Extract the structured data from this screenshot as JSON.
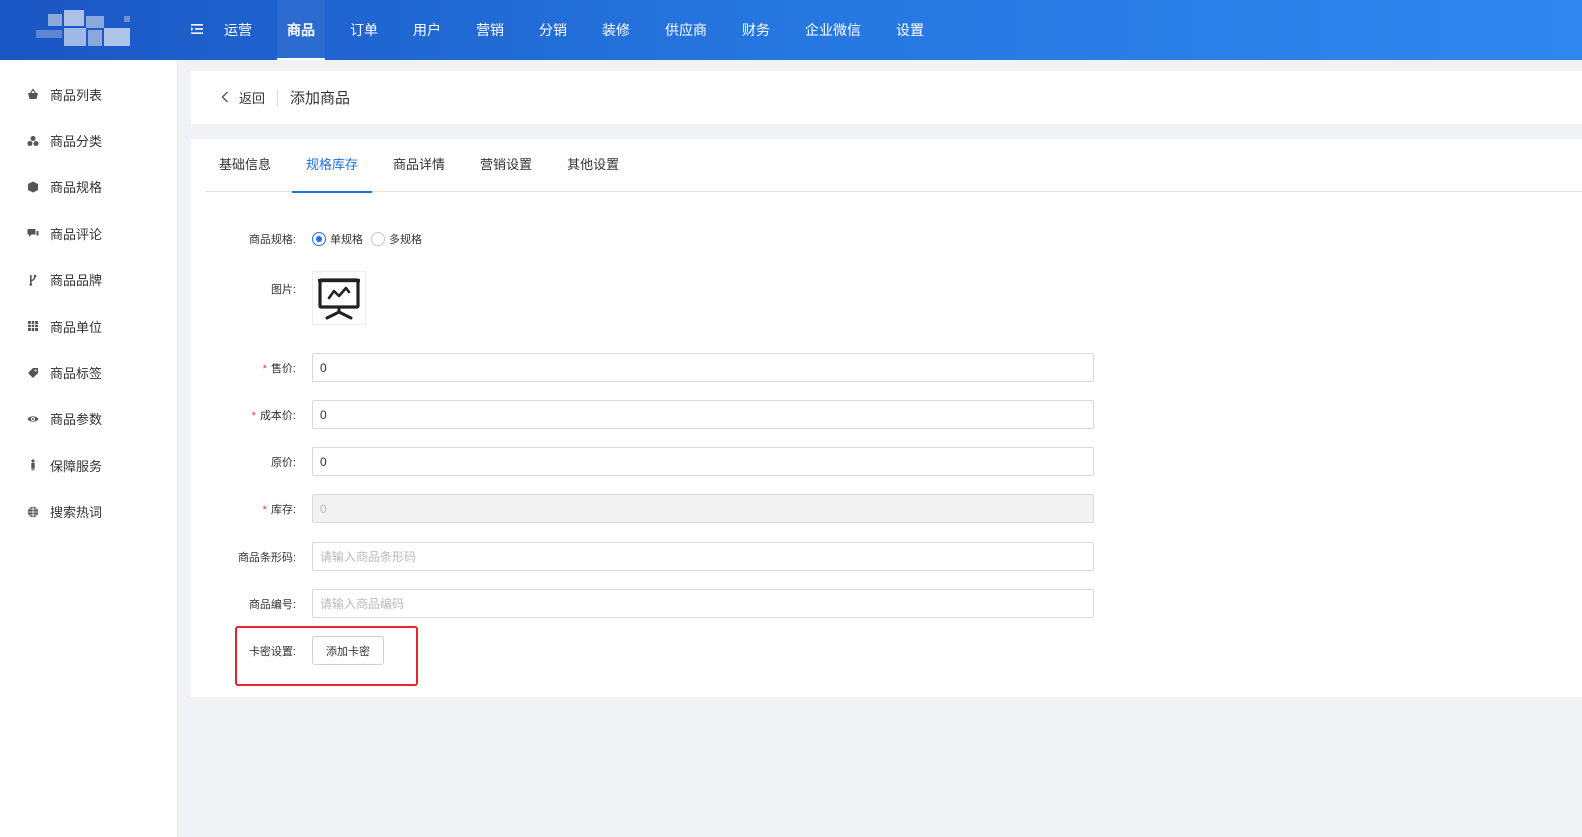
{
  "header": {
    "nav": [
      {
        "label": "运营"
      },
      {
        "label": "商品"
      },
      {
        "label": "订单"
      },
      {
        "label": "用户"
      },
      {
        "label": "营销"
      },
      {
        "label": "分销"
      },
      {
        "label": "装修"
      },
      {
        "label": "供应商"
      },
      {
        "label": "财务"
      },
      {
        "label": "企业微信"
      },
      {
        "label": "设置"
      }
    ],
    "active_nav": "商品",
    "colors": {
      "gradient_start": "#1a56c4",
      "gradient_end": "#2f86ee"
    }
  },
  "sidebar": {
    "items": [
      {
        "label": "商品列表",
        "icon": "basket-icon"
      },
      {
        "label": "商品分类",
        "icon": "cubes-icon"
      },
      {
        "label": "商品规格",
        "icon": "cube-icon"
      },
      {
        "label": "商品评论",
        "icon": "comments-icon"
      },
      {
        "label": "商品品牌",
        "icon": "branch-icon"
      },
      {
        "label": "商品单位",
        "icon": "grid-icon"
      },
      {
        "label": "商品标签",
        "icon": "tag-icon"
      },
      {
        "label": "商品参数",
        "icon": "eye-icon"
      },
      {
        "label": "保障服务",
        "icon": "person-icon"
      },
      {
        "label": "搜索热词",
        "icon": "globe-icon"
      }
    ]
  },
  "breadcrumb": {
    "back_label": "返回",
    "title": "添加商品"
  },
  "tabs": [
    {
      "label": "基础信息"
    },
    {
      "label": "规格库存"
    },
    {
      "label": "商品详情"
    },
    {
      "label": "营销设置"
    },
    {
      "label": "其他设置"
    }
  ],
  "active_tab": "规格库存",
  "form": {
    "spec": {
      "label": "商品规格:",
      "options": [
        "单规格",
        "多规格"
      ],
      "selected": "单规格"
    },
    "image": {
      "label": "图片:",
      "icon": "presentation-board-icon"
    },
    "price": {
      "label": "售价:",
      "required": true,
      "value": "0"
    },
    "cost": {
      "label": "成本价:",
      "required": true,
      "value": "0"
    },
    "original": {
      "label": "原价:",
      "required": false,
      "value": "0"
    },
    "stock": {
      "label": "库存:",
      "required": true,
      "value": "0",
      "disabled": true
    },
    "barcode": {
      "label": "商品条形码:",
      "placeholder": "请输入商品条形码"
    },
    "code": {
      "label": "商品编号:",
      "placeholder": "请输入商品编码"
    },
    "card": {
      "label": "卡密设置:",
      "button": "添加卡密"
    }
  },
  "accent_color": "#1d71e0",
  "highlight_color": "#e8242c"
}
